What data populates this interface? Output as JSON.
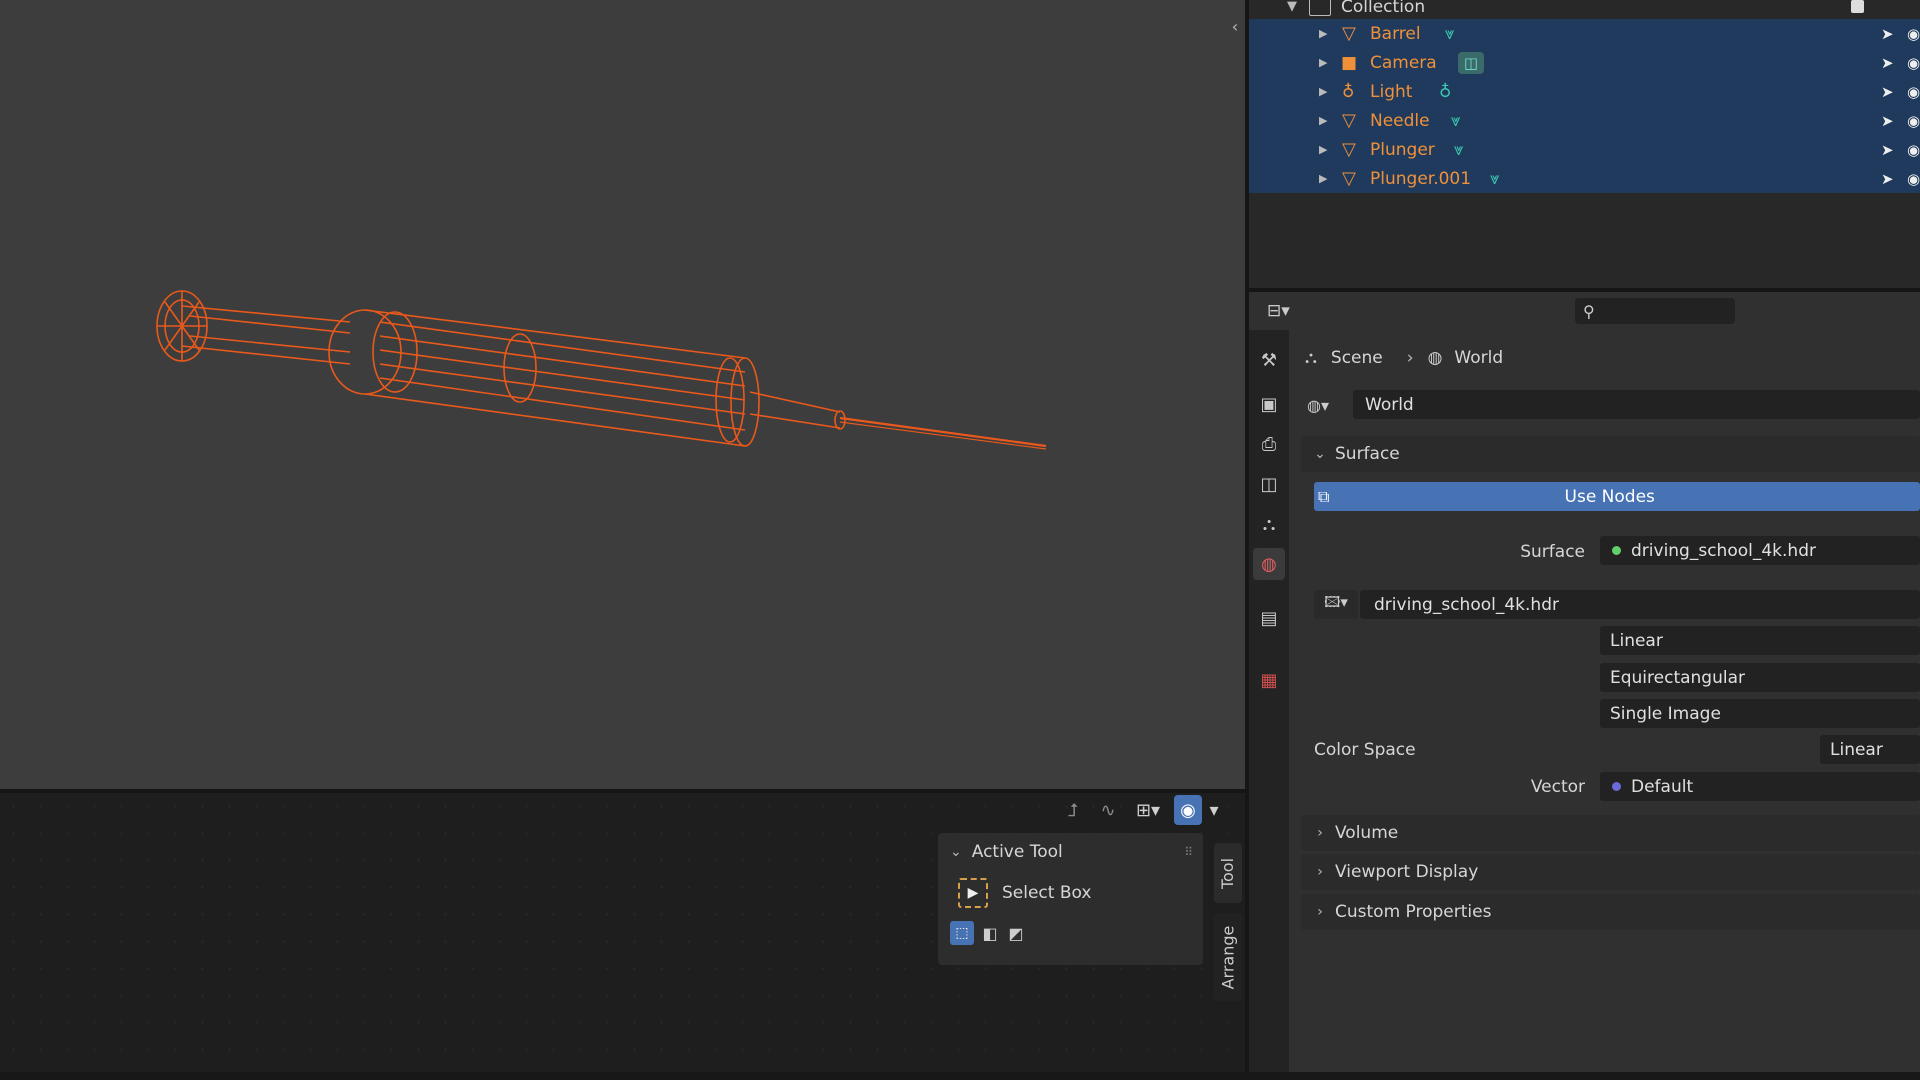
{
  "outliner": {
    "collection_label": "Collection",
    "items": [
      {
        "name": "Barrel",
        "type_icon": "mesh-icon",
        "data_icon": "mesh-data-icon"
      },
      {
        "name": "Camera",
        "type_icon": "camera-icon",
        "data_icon": "camera-data-icon"
      },
      {
        "name": "Light",
        "type_icon": "light-icon",
        "data_icon": "light-data-icon"
      },
      {
        "name": "Needle",
        "type_icon": "mesh-icon",
        "data_icon": "mesh-data-icon"
      },
      {
        "name": "Plunger",
        "type_icon": "mesh-icon",
        "data_icon": "mesh-data-icon"
      },
      {
        "name": "Plunger.001",
        "type_icon": "mesh-icon",
        "data_icon": "mesh-data-icon"
      }
    ]
  },
  "properties": {
    "search_placeholder": "",
    "breadcrumb": {
      "scene": "Scene",
      "world": "World"
    },
    "world_name": "World",
    "surface_section": "Surface",
    "use_nodes_label": "Use Nodes",
    "surface_label": "Surface",
    "surface_value": "driving_school_4k.hdr",
    "image_name": "driving_school_4k.hdr",
    "interpolation": "Linear",
    "projection": "Equirectangular",
    "source": "Single Image",
    "color_space_label": "Color Space",
    "color_space_value": "Linear",
    "vector_label": "Vector",
    "vector_value": "Default",
    "collapsed_sections": [
      "Volume",
      "Viewport Display",
      "Custom Properties"
    ]
  },
  "tool_panel": {
    "title": "Active Tool",
    "tool_name": "Select Box",
    "tabs": [
      "Tool",
      "Arrange"
    ]
  },
  "colors": {
    "accent_orange": "#e9591c",
    "selection_blue": "#1f3a5c",
    "use_nodes_blue": "#4772b3",
    "teal_data": "#3cc7b0"
  }
}
